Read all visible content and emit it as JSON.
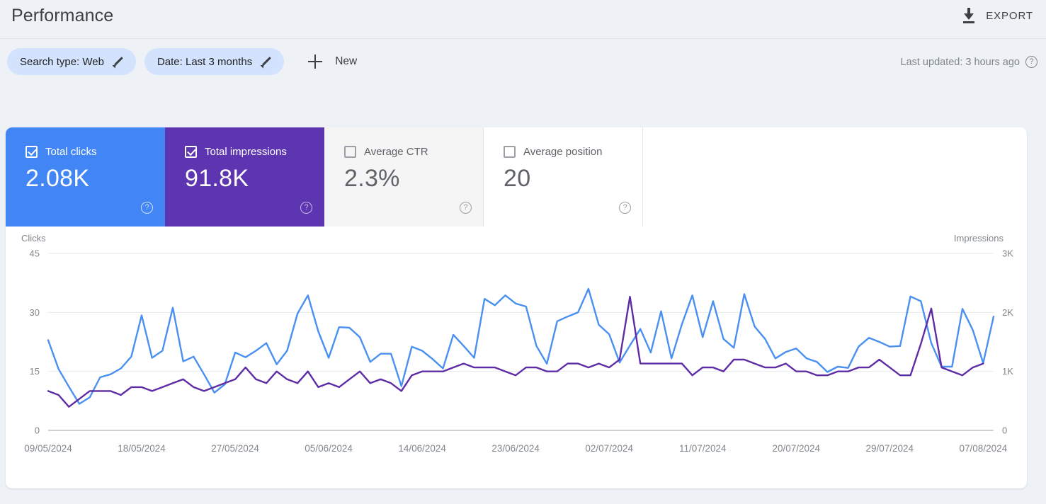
{
  "header": {
    "title": "Performance",
    "export_label": "EXPORT",
    "export_icon": "download-icon"
  },
  "filters": {
    "chips": [
      {
        "label": "Search type: Web",
        "icon": "pencil-icon"
      },
      {
        "label": "Date: Last 3 months",
        "icon": "pencil-icon"
      }
    ],
    "new_label": "New",
    "new_icon": "plus-icon",
    "last_updated": "Last updated: 3 hours ago",
    "help_icon": "help-icon"
  },
  "metrics": [
    {
      "label": "Total clicks",
      "value": "2.08K",
      "checked": true,
      "theme": "blue",
      "color": "#4285f4"
    },
    {
      "label": "Total impressions",
      "value": "91.8K",
      "checked": true,
      "theme": "purple",
      "color": "#5e35b1"
    },
    {
      "label": "Average CTR",
      "value": "2.3%",
      "checked": false,
      "theme": "gray",
      "color": "#f5f5f5"
    },
    {
      "label": "Average position",
      "value": "20",
      "checked": false,
      "theme": "white",
      "color": "#ffffff"
    }
  ],
  "chart_data": {
    "type": "line",
    "title": "",
    "ylabel": "Clicks",
    "y2label": "Impressions",
    "xlabel": "",
    "ylim": [
      0,
      45
    ],
    "y2lim": [
      0,
      3000
    ],
    "yticks": [
      "0",
      "15",
      "30",
      "45"
    ],
    "y2ticks": [
      "0",
      "1K",
      "2K",
      "3K"
    ],
    "grid": true,
    "legend": "none",
    "xticks": [
      "09/05/2024",
      "18/05/2024",
      "27/05/2024",
      "05/06/2024",
      "14/06/2024",
      "23/06/2024",
      "02/07/2024",
      "11/07/2024",
      "20/07/2024",
      "29/07/2024",
      "07/08/2024"
    ],
    "xtick_indices": [
      0,
      9,
      18,
      27,
      36,
      45,
      54,
      63,
      72,
      81,
      90
    ],
    "series": [
      {
        "name": "Total impressions",
        "color": "#4a90f0",
        "axis": "right",
        "unit": "impressions",
        "values": [
          1530,
          1040,
          740,
          450,
          560,
          900,
          950,
          1050,
          1250,
          1950,
          1230,
          1350,
          2080,
          1170,
          1250,
          950,
          640,
          780,
          1320,
          1240,
          1350,
          1480,
          1120,
          1350,
          1980,
          2290,
          1680,
          1230,
          1750,
          1740,
          1580,
          1160,
          1300,
          1300,
          750,
          1420,
          1350,
          1210,
          1050,
          1620,
          1430,
          1230,
          2230,
          2120,
          2290,
          2150,
          2100,
          1430,
          1130,
          1850,
          1930,
          2000,
          2400,
          1790,
          1630,
          1150,
          1440,
          1720,
          1320,
          2020,
          1220,
          1800,
          2290,
          1580,
          2190,
          1550,
          1400,
          2310,
          1760,
          1550,
          1220,
          1330,
          1390,
          1220,
          1160,
          990,
          1080,
          1060,
          1420,
          1570,
          1500,
          1420,
          1430,
          2270,
          2190,
          1480,
          1080,
          1080,
          2060,
          1700,
          1140,
          1930
        ]
      },
      {
        "name": "Total clicks",
        "color": "#5e2ca5",
        "axis": "left",
        "unit": "clicks",
        "values": [
          10,
          9,
          6,
          8,
          10,
          10,
          10,
          9,
          11,
          11,
          10,
          11,
          12,
          13,
          11,
          10,
          11,
          12,
          13,
          16,
          13,
          12,
          15,
          13,
          12,
          15,
          11,
          12,
          11,
          13,
          15,
          12,
          13,
          12,
          10,
          14,
          15,
          15,
          15,
          16,
          17,
          16,
          16,
          16,
          15,
          14,
          16,
          16,
          15,
          15,
          17,
          17,
          16,
          17,
          16,
          18,
          34,
          17,
          17,
          17,
          17,
          17,
          14,
          16,
          16,
          15,
          18,
          18,
          17,
          16,
          16,
          17,
          15,
          15,
          14,
          14,
          15,
          15,
          16,
          16,
          18,
          16,
          14,
          14,
          22,
          31,
          16,
          15,
          14,
          16,
          17
        ]
      }
    ]
  }
}
